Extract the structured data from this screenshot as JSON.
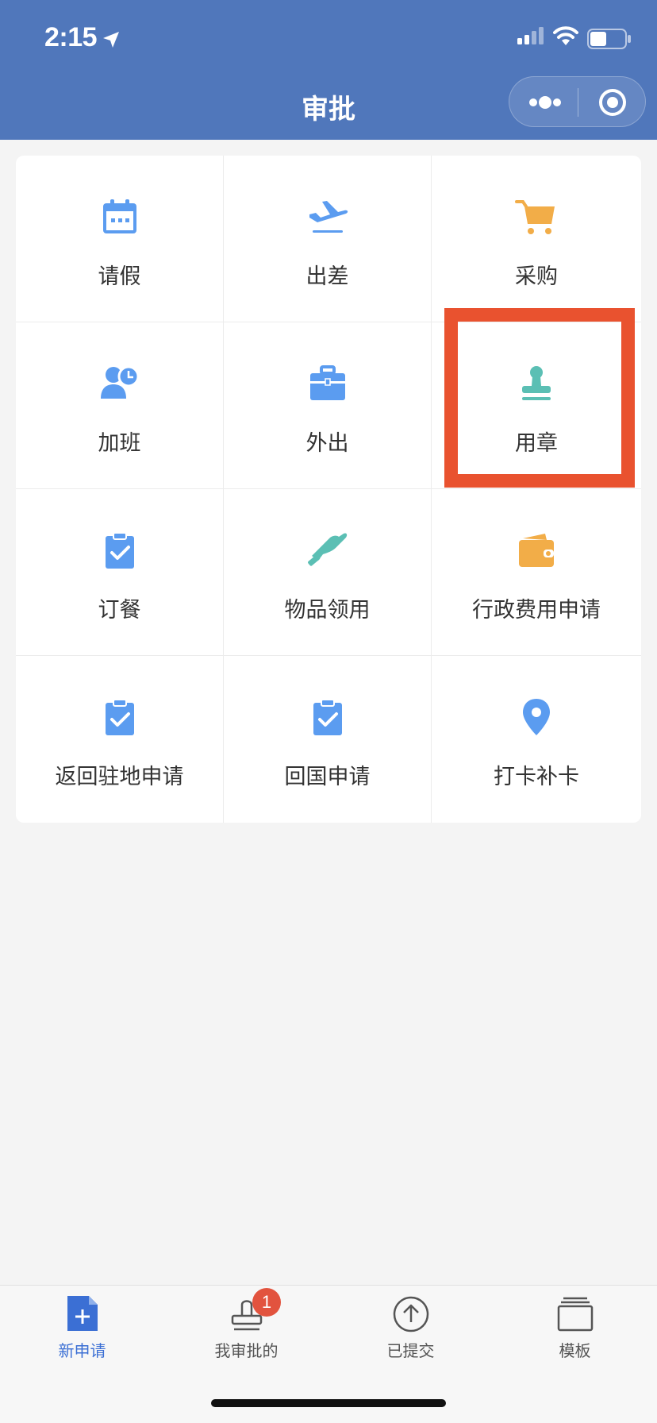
{
  "status_bar": {
    "time": "2:15"
  },
  "nav": {
    "title": "审批"
  },
  "grid": {
    "items": [
      {
        "label": "请假",
        "icon": "calendar-icon",
        "color": "#5b9cf0"
      },
      {
        "label": "出差",
        "icon": "airplane-icon",
        "color": "#5b9cf0"
      },
      {
        "label": "采购",
        "icon": "cart-icon",
        "color": "#f2ad48"
      },
      {
        "label": "加班",
        "icon": "overtime-icon",
        "color": "#5b9cf0"
      },
      {
        "label": "外出",
        "icon": "briefcase-icon",
        "color": "#5b9cf0"
      },
      {
        "label": "用章",
        "icon": "stamp-icon",
        "color": "#5bbfb4"
      },
      {
        "label": "订餐",
        "icon": "clipboard-check-icon",
        "color": "#5b9cf0"
      },
      {
        "label": "物品领用",
        "icon": "hand-icon",
        "color": "#5bbfb4"
      },
      {
        "label": "行政费用申请",
        "icon": "wallet-icon",
        "color": "#f2ad48"
      },
      {
        "label": "返回驻地申请",
        "icon": "clipboard-check-icon",
        "color": "#5b9cf0"
      },
      {
        "label": "回国申请",
        "icon": "clipboard-check-icon",
        "color": "#5b9cf0"
      },
      {
        "label": "打卡补卡",
        "icon": "location-pin-icon",
        "color": "#5b9cf0"
      }
    ]
  },
  "tabbar": {
    "tabs": [
      {
        "label": "新申请",
        "icon": "new-document-icon",
        "active": true
      },
      {
        "label": "我审批的",
        "icon": "stamp-outline-icon",
        "badge": "1"
      },
      {
        "label": "已提交",
        "icon": "upload-circle-icon"
      },
      {
        "label": "模板",
        "icon": "template-stack-icon"
      }
    ]
  },
  "colors": {
    "header": "#5077bb",
    "highlight": "#e9522f",
    "active_tab": "#3b6fd4",
    "badge": "#e2533e"
  }
}
